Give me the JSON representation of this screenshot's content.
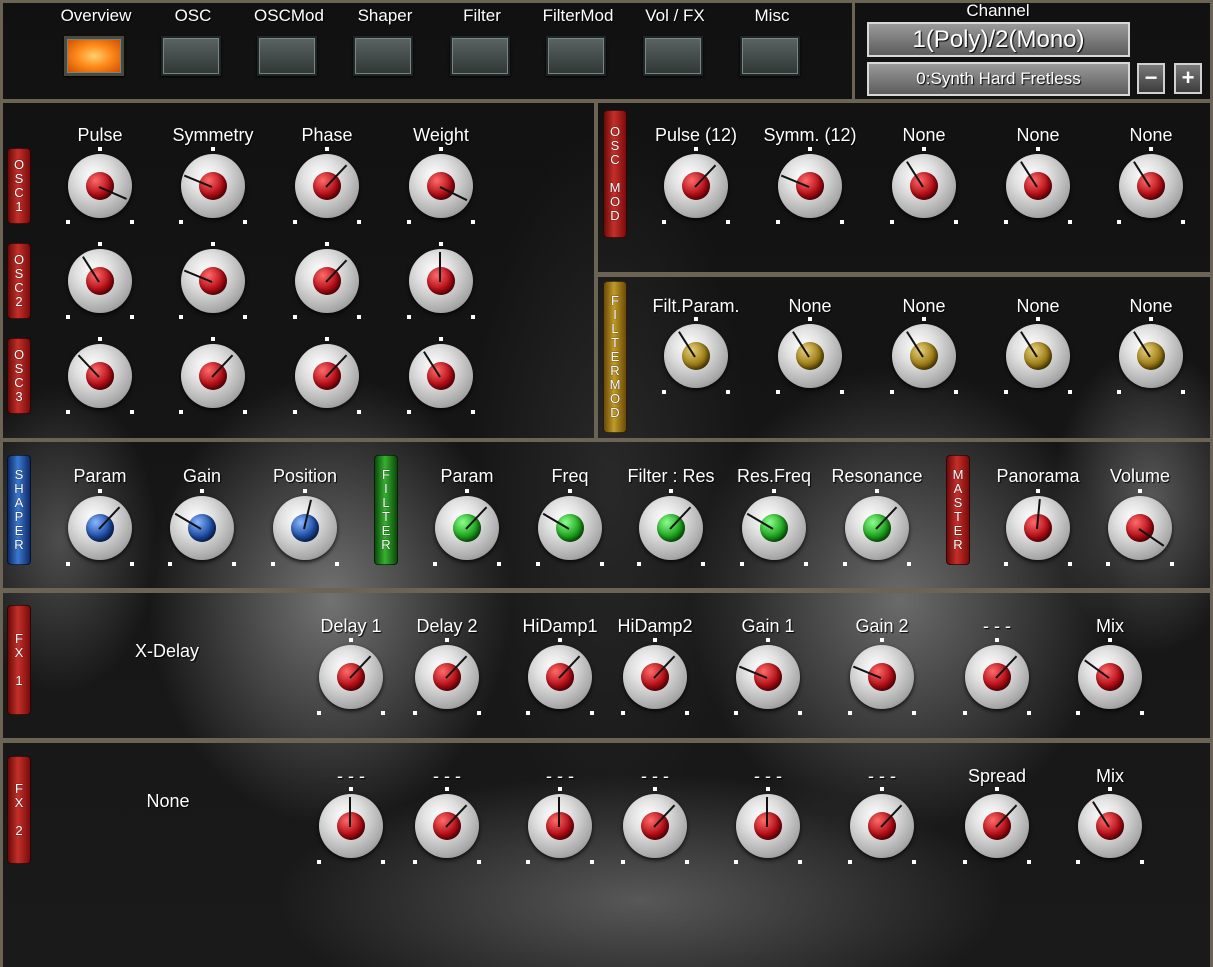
{
  "nav": {
    "buttons": [
      {
        "label": "Overview",
        "active": true
      },
      {
        "label": "OSC",
        "active": false
      },
      {
        "label": "OSCMod",
        "active": false
      },
      {
        "label": "Shaper",
        "active": false
      },
      {
        "label": "Filter",
        "active": false
      },
      {
        "label": "FilterMod",
        "active": false
      },
      {
        "label": "Vol / FX",
        "active": false
      },
      {
        "label": "Misc",
        "active": false
      }
    ]
  },
  "channel": {
    "title": "Channel",
    "mode": "1(Poly)/2(Mono)",
    "preset": "0:Synth Hard Fretless",
    "minus_label": "−",
    "plus_label": "+"
  },
  "osc": {
    "tags": [
      "OSC 1",
      "OSC 2",
      "OSC 3"
    ],
    "params": [
      "Pulse",
      "Symmetry",
      "Phase",
      "Weight"
    ],
    "rows": [
      [
        0.92,
        0.25,
        0.66,
        0.93
      ],
      [
        0.38,
        0.25,
        0.66,
        0.5
      ],
      [
        0.34,
        0.66,
        0.66,
        0.38
      ]
    ]
  },
  "osc_mod": {
    "tag": "OSC MOD",
    "params": [
      "Pulse (12)",
      "Symm. (12)",
      "None",
      "None",
      "None"
    ],
    "values": [
      0.66,
      0.25,
      0.38,
      0.38,
      0.38
    ]
  },
  "filter_mod": {
    "tag": "FILTER MOD",
    "params": [
      "Filt.Param.",
      "None",
      "None",
      "None",
      "None"
    ],
    "values": [
      0.38,
      0.38,
      0.38,
      0.38,
      0.38
    ]
  },
  "shaper": {
    "tag": "SHAPER",
    "params": [
      "Param",
      "Gain",
      "Position"
    ],
    "values": [
      0.66,
      0.28,
      0.55
    ]
  },
  "filter": {
    "tag": "FILTER",
    "params": [
      "Param",
      "Freq",
      "Filter : Res",
      "Res.Freq",
      "Resonance"
    ],
    "values": [
      0.66,
      0.28,
      0.66,
      0.28,
      0.66
    ]
  },
  "master": {
    "tag": "MASTER",
    "params": [
      "Panorama",
      "Volume"
    ],
    "values": [
      0.52,
      0.96
    ]
  },
  "fx1": {
    "tag": "FX 1",
    "name": "X-Delay",
    "params": [
      "Delay 1",
      "Delay 2",
      "HiDamp1",
      "HiDamp2",
      "Gain 1",
      "Gain 2",
      "- - -",
      "Mix"
    ],
    "values": [
      0.66,
      0.66,
      0.66,
      0.66,
      0.25,
      0.25,
      0.66,
      0.3
    ]
  },
  "fx2": {
    "tag": "FX 2",
    "name": "None",
    "params": [
      "- - -",
      "- - -",
      "- - -",
      "- - -",
      "- - -",
      "- - -",
      "Spread",
      "Mix"
    ],
    "values": [
      0.5,
      0.66,
      0.5,
      0.66,
      0.5,
      0.66,
      0.66,
      0.38
    ]
  }
}
